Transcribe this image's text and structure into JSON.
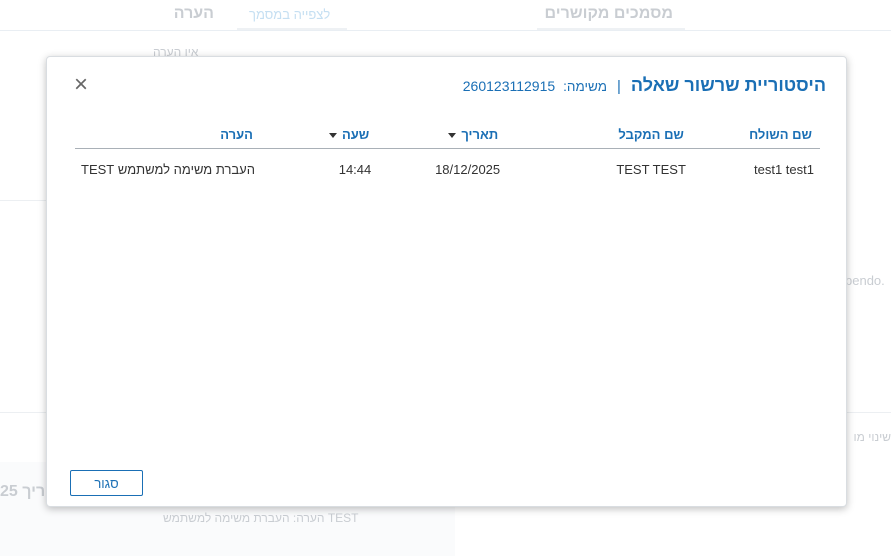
{
  "background": {
    "tabs": {
      "related_docs": "מסמכים מקושרים",
      "note": "הערה"
    },
    "preview_link": "לצפייה במסמך",
    "no_note": "אין הערה",
    "side_text": "pendo.",
    "side_label": "שינוי מו",
    "panel_date": "ריך 25",
    "panel_note": "הערה: העברת משימה למשתמש TEST"
  },
  "modal": {
    "title": "היסטוריית שרשור שאלה",
    "separator": "|",
    "task_label": "משימה:",
    "task_number": "260123112915",
    "close_icon": "×",
    "close_icon_name": "close-icon",
    "columns": {
      "sender": "שם השולח",
      "receiver": "שם המקבל",
      "date": "תאריך",
      "time": "שעה",
      "note": "הערה"
    },
    "rows": [
      {
        "sender": "test1 test1",
        "receiver": "TEST TEST",
        "date": "18/12/2025",
        "time": "14:44",
        "note": "העברת משימה למשתמש TEST"
      }
    ],
    "footer": {
      "close_label": "סגור"
    }
  },
  "colors": {
    "accent": "#1a6fb5",
    "text": "#333333",
    "muted": "#c9cdd2"
  }
}
